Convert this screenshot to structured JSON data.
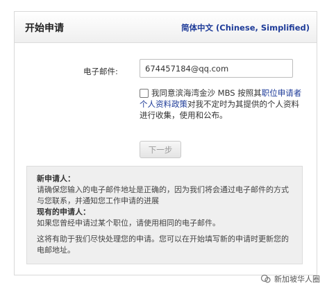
{
  "header": {
    "title": "开始申请",
    "language_link": "简体中文 (Chinese, Simplified)"
  },
  "form": {
    "email_label": "电子邮件:",
    "email_value": "674457184@qq.com",
    "consent_checked": false,
    "consent_prefix": "我同意滨海湾金沙 MBS 按照其",
    "consent_link": "职位申请者个人资料政策",
    "consent_suffix": "对我不定时为其提供的个人资料进行收集，使用和公布。",
    "next_button": "下一步"
  },
  "info": {
    "new_heading": "新申请人：",
    "new_text": "请确保您输入的电子邮件地址是正确的，因为我们将会通过电子邮件的方式与您联系，并通知您工作申请的进展",
    "existing_heading": "现有的申请人：",
    "existing_text": "如果您曾经申请过某个职位，请使用相同的电子邮件。",
    "note_text": "这将有助于我们尽快处理您的申请。您可以在开始填写新的申请时更新您的电邮地址。"
  },
  "watermark": {
    "icon": "wechat-icon",
    "text": "新加坡华人圈"
  }
}
